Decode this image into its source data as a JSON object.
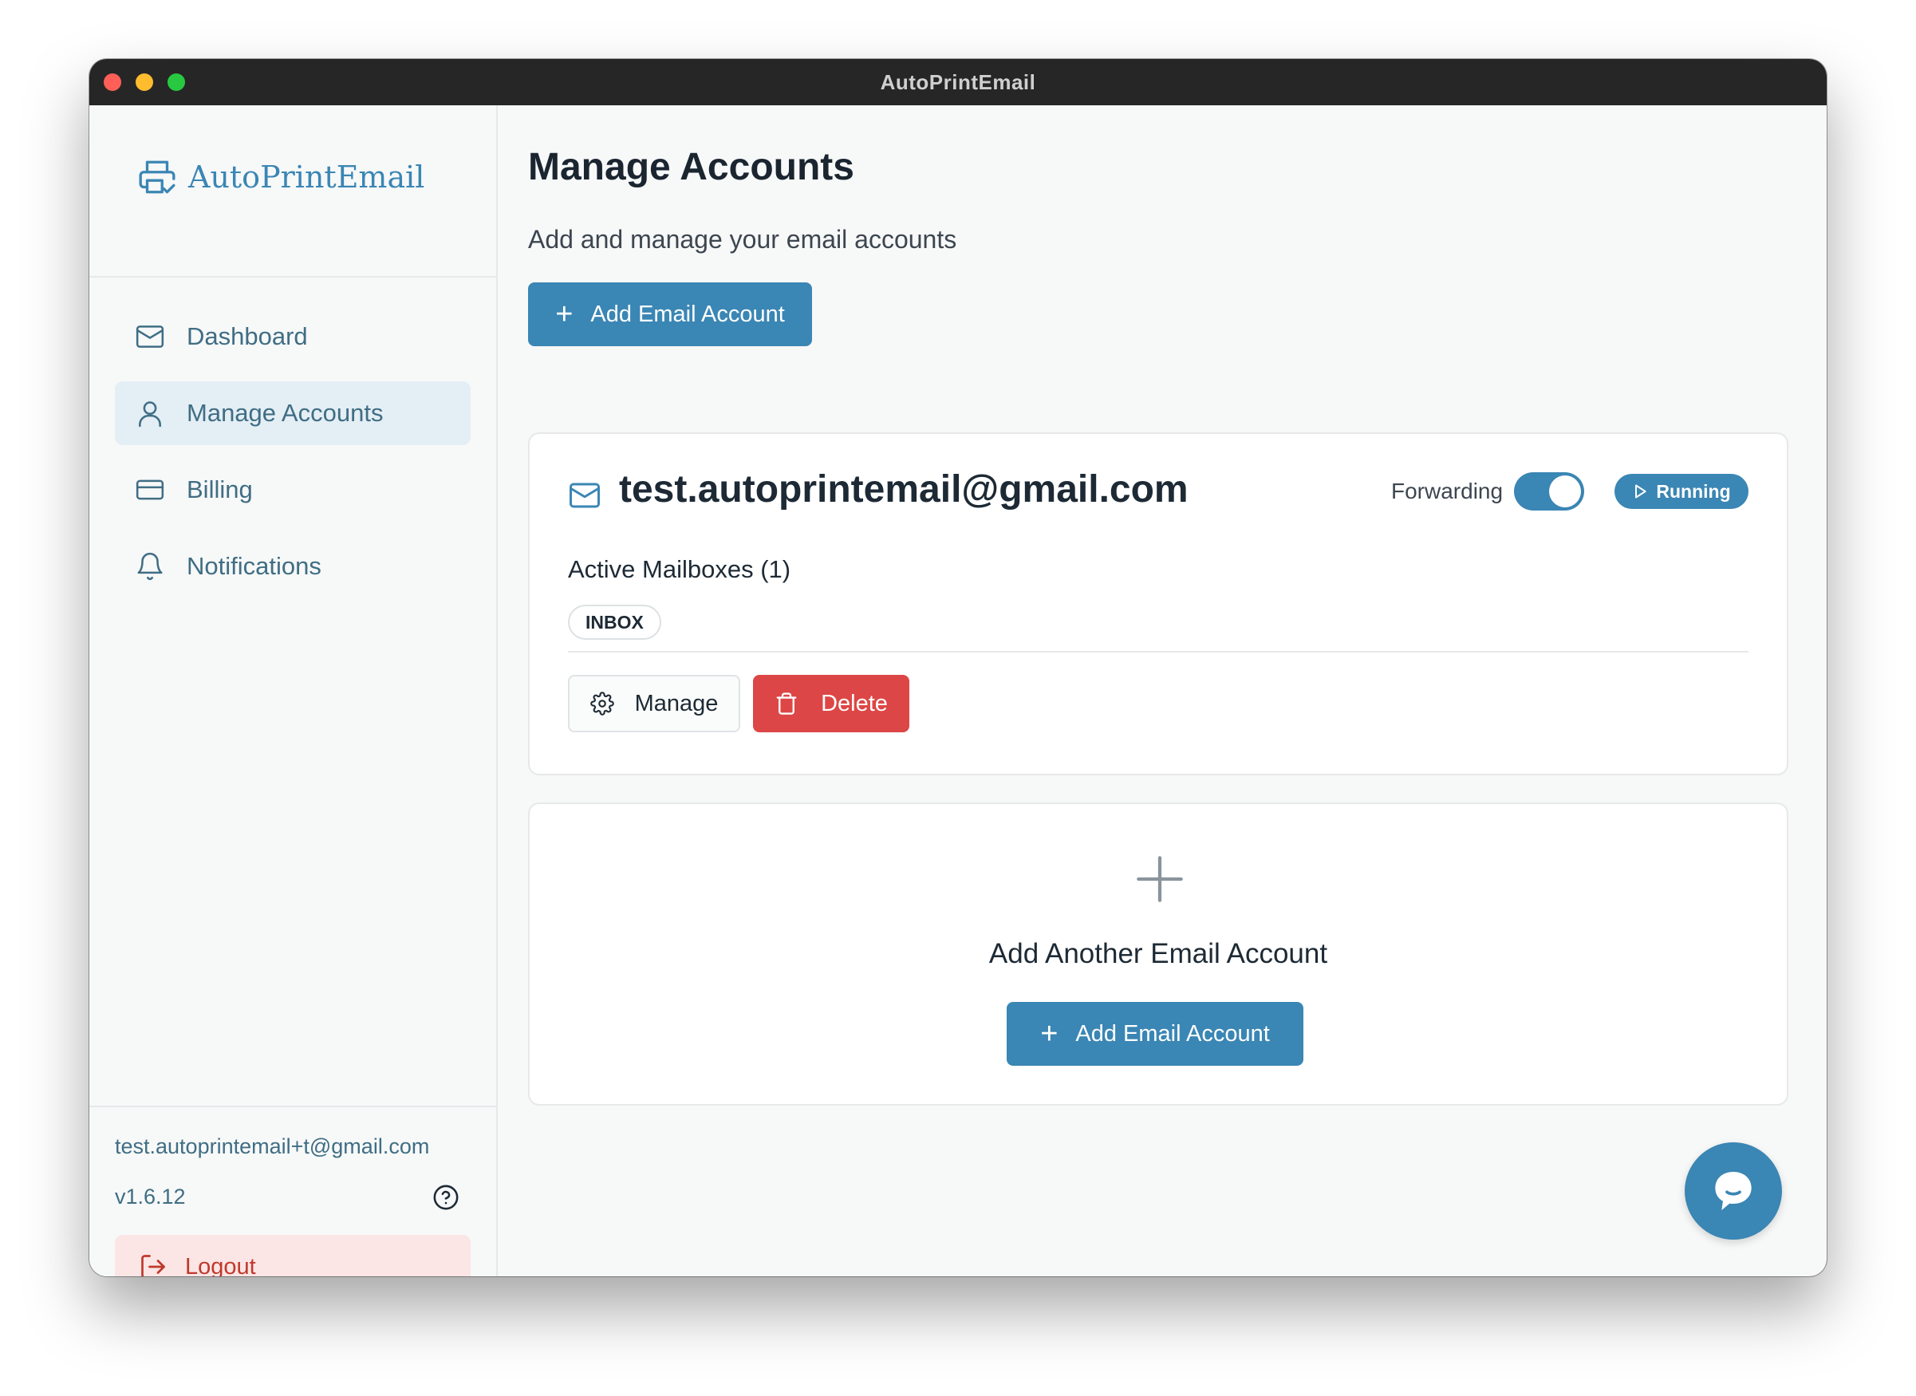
{
  "window": {
    "title": "AutoPrintEmail"
  },
  "sidebar": {
    "brand": "AutoPrintEmail",
    "items": [
      {
        "label": "Dashboard",
        "icon": "mail-icon",
        "active": false
      },
      {
        "label": "Manage Accounts",
        "icon": "user-icon",
        "active": true
      },
      {
        "label": "Billing",
        "icon": "credit-card-icon",
        "active": false
      },
      {
        "label": "Notifications",
        "icon": "bell-icon",
        "active": false
      }
    ],
    "user_email": "test.autoprintemail+t@gmail.com",
    "version": "v1.6.12",
    "logout_label": "Logout"
  },
  "main": {
    "title": "Manage Accounts",
    "subtitle": "Add and manage your email accounts",
    "add_button_label": "Add Email Account",
    "account": {
      "email": "test.autoprintemail@gmail.com",
      "forwarding_label": "Forwarding",
      "forwarding_enabled": true,
      "status_label": "Running",
      "mailboxes_label": "Active Mailboxes (1)",
      "mailboxes": [
        "INBOX"
      ],
      "manage_label": "Manage",
      "delete_label": "Delete"
    },
    "add_card": {
      "label": "Add Another Email Account",
      "button_label": "Add Email Account"
    }
  },
  "colors": {
    "accent": "#3a86b4",
    "danger": "#dd4646",
    "logout_bg": "#fbe5e5",
    "active_nav_bg": "#e4eef5"
  }
}
